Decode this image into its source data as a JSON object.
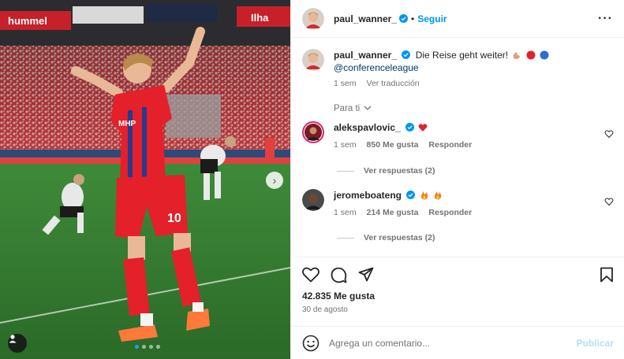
{
  "post": {
    "author": "paul_wanner_",
    "follow_label": "Seguir",
    "more_icon": "more-horizontal-icon",
    "image_alt": "Jugador celebrando en el estadio",
    "jersey_number": "10",
    "sponsor": "MHP",
    "stadium_banner_left": "hummel",
    "stadium_banner_right": "Ilha",
    "carousel": {
      "count": 4,
      "active_index": 0
    }
  },
  "caption": {
    "author": "paul_wanner_",
    "text": "Die Reise geht weiter!",
    "mention": "@conferenceleague",
    "time": "1 sem",
    "translate": "Ver traducción",
    "emojis": [
      "flexed-biceps",
      "red-circle",
      "blue-circle"
    ]
  },
  "sort_label": "Para ti",
  "comments": [
    {
      "author": "alekspavlovic_",
      "emoji": "red-heart",
      "time": "1 sem",
      "likes": "850 Me gusta",
      "reply_label": "Responder",
      "view_replies": "Ver respuestas (2)"
    },
    {
      "author": "jeromeboateng",
      "emoji": "fire-fire",
      "time": "1 sem",
      "likes": "214 Me gusta",
      "reply_label": "Responder",
      "view_replies": "Ver respuestas (2)"
    }
  ],
  "stats": {
    "likes": "42.835 Me gusta",
    "date": "30 de agosto"
  },
  "composer": {
    "placeholder": "Agrega un comentario...",
    "post_label": "Publicar"
  },
  "colors": {
    "accent": "#0095f6",
    "link": "#00376b",
    "muted": "#737373",
    "jersey_red": "#e4202a",
    "pitch_green": "#2f7a2e"
  }
}
